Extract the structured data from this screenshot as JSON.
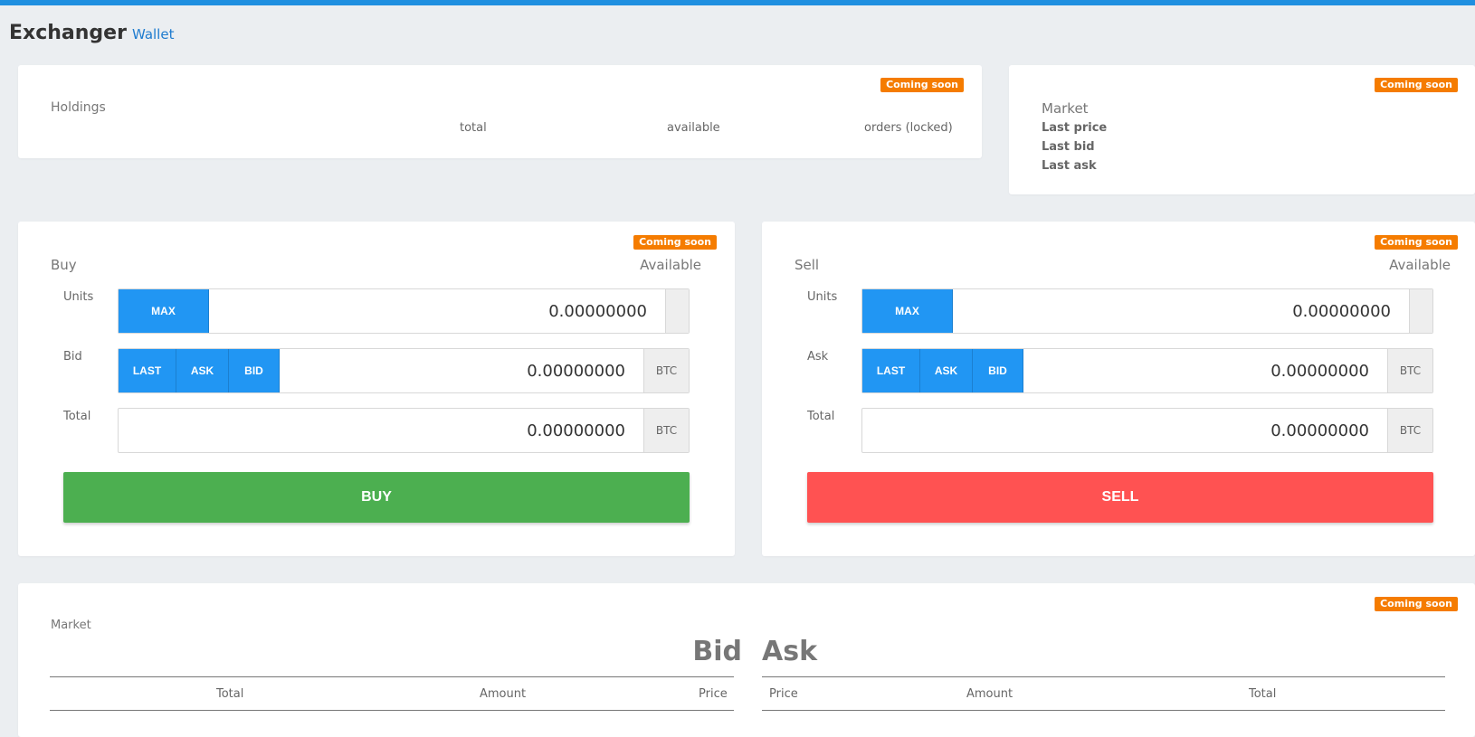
{
  "header": {
    "title": "Exchanger",
    "wallet_link": "Wallet"
  },
  "badge_text": "Coming soon",
  "holdings": {
    "title": "Holdings",
    "columns": [
      "total",
      "available",
      "orders (locked)"
    ]
  },
  "market_summary": {
    "title": "Market",
    "last_price": "Last price",
    "last_bid": "Last bid",
    "last_ask": "Last ask"
  },
  "buy": {
    "title": "Buy",
    "available_label": "Available",
    "units_label": "Units",
    "units_value": "0.00000000",
    "max_label": "MAX",
    "price_label": "Bid",
    "price_value": "0.00000000",
    "price_buttons": [
      "LAST",
      "ASK",
      "BID"
    ],
    "total_label": "Total",
    "total_value": "0.00000000",
    "currency": "BTC",
    "action_label": "BUY"
  },
  "sell": {
    "title": "Sell",
    "available_label": "Available",
    "units_label": "Units",
    "units_value": "0.00000000",
    "max_label": "MAX",
    "price_label": "Ask",
    "price_value": "0.00000000",
    "price_buttons": [
      "LAST",
      "ASK",
      "BID"
    ],
    "total_label": "Total",
    "total_value": "0.00000000",
    "currency": "BTC",
    "action_label": "SELL"
  },
  "order_book": {
    "title": "Market",
    "bid_heading": "Bid",
    "ask_heading": "Ask",
    "bid_columns": [
      "Total",
      "Amount",
      "Price"
    ],
    "ask_columns": [
      "Price",
      "Amount",
      "Total"
    ]
  },
  "colors": {
    "accent": "#2196f3",
    "buy": "#4caf50",
    "sell": "#ff5252",
    "badge": "#f57c00"
  }
}
